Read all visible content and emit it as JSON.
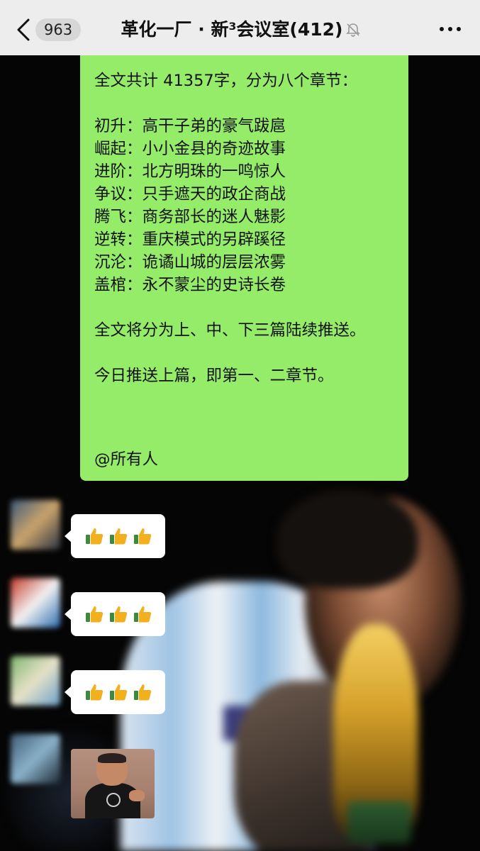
{
  "header": {
    "back_badge": "963",
    "title": "革化一厂 · 新³会议室(412)",
    "mute_icon": "mute-bell-icon",
    "more_icon": "more-dots-icon"
  },
  "message_main": {
    "intro": "全文共计 41357字，分为八个章节：",
    "chapters": [
      "初升：高干子弟的豪气跋扈",
      "崛起：小小金县的奇迹故事",
      "进阶：北方明珠的一鸣惊人",
      "争议：只手遮天的政企商战",
      "腾飞：商务部长的迷人魅影",
      "逆转：重庆模式的另辟蹊径",
      "沉沦：诡谲山城的层层浓雾",
      "盖棺：永不蒙尘的史诗长卷"
    ],
    "schedule": "全文将分为上、中、下三篇陆续推送。",
    "today": "今日推送上篇，即第一、二章节。",
    "mention": "@所有人",
    "bubble_color": "#95ec69"
  },
  "replies": [
    {
      "content_icon": "thumbs-up-icon",
      "count": 3
    },
    {
      "content_icon": "thumbs-up-icon",
      "count": 3
    },
    {
      "content_icon": "thumbs-up-icon",
      "count": 3
    }
  ]
}
